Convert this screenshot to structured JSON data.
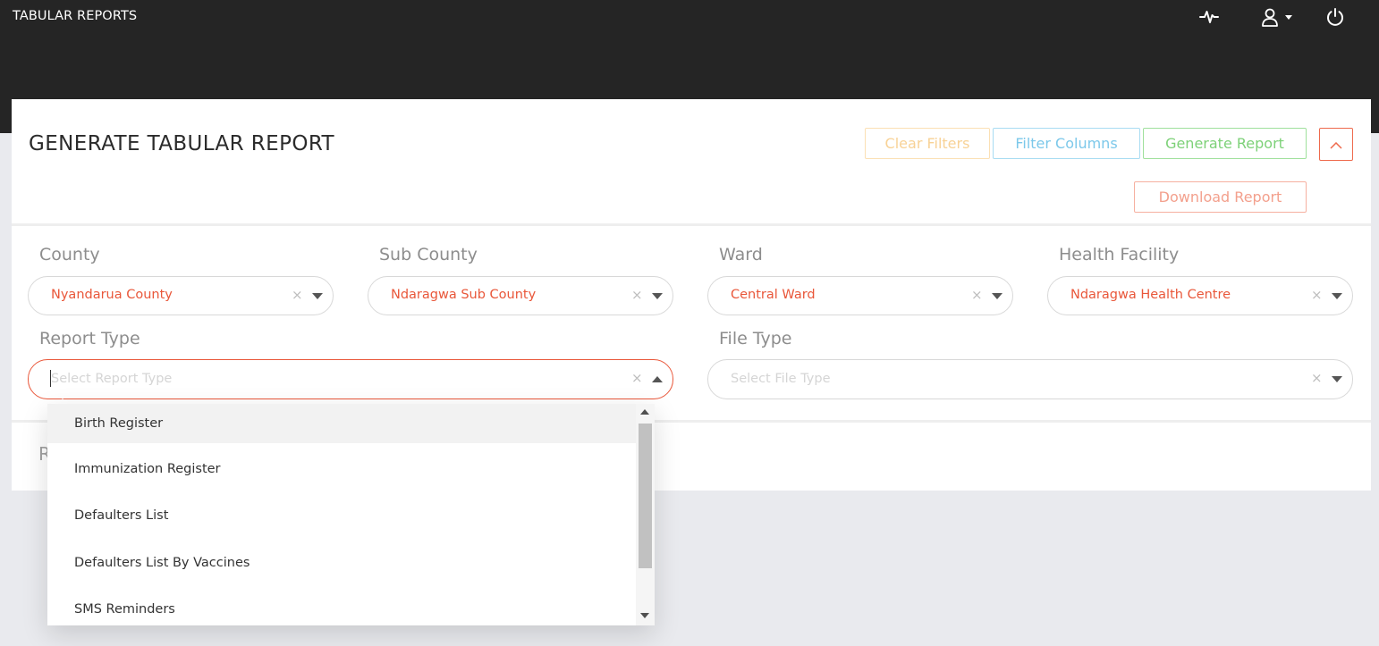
{
  "app": {
    "title": "TABULAR REPORTS"
  },
  "header_icons": [
    "activity-icon",
    "user-icon",
    "power-icon"
  ],
  "card": {
    "title": "GENERATE TABULAR REPORT",
    "buttons": {
      "clear_filters": "Clear Filters",
      "filter_columns": "Filter Columns",
      "generate_report": "Generate Report",
      "download_report": "Download Report"
    },
    "footer_stub": "R"
  },
  "filters": {
    "county": {
      "label": "County",
      "value": "Nyandarua County"
    },
    "sub_county": {
      "label": "Sub County",
      "value": "Ndaragwa Sub County"
    },
    "ward": {
      "label": "Ward",
      "value": "Central Ward"
    },
    "health_facility": {
      "label": "Health Facility",
      "value": "Ndaragwa Health Centre"
    },
    "report_type": {
      "label": "Report Type",
      "placeholder": "Select Report Type"
    },
    "file_type": {
      "label": "File Type",
      "placeholder": "Select File Type"
    }
  },
  "report_type_options": [
    "Birth Register",
    "Immunization Register",
    "Defaulters List",
    "Defaulters List By Vaccines",
    "SMS Reminders"
  ],
  "colors": {
    "header_bg": "#252525",
    "accent": "#e9573a",
    "clear_btn": "#f8d296",
    "filter_btn": "#7cc8ea",
    "generate_btn": "#7dd178",
    "download_btn": "#f3a08d"
  }
}
